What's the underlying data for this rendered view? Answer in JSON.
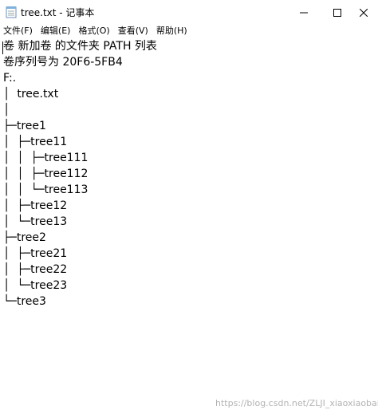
{
  "window": {
    "title": "tree.txt - 记事本"
  },
  "menu": {
    "items": [
      "文件(F)",
      "编辑(E)",
      "格式(O)",
      "查看(V)",
      "帮助(H)"
    ]
  },
  "editor": {
    "lines": [
      "卷 新加卷 的文件夹 PATH 列表",
      "卷序列号为 20F6-5FB4",
      "F:.",
      "│  tree.txt",
      "│",
      "├─tree1",
      "│  ├─tree11",
      "│  │  ├─tree111",
      "│  │  ├─tree112",
      "│  │  └─tree113",
      "│  ├─tree12",
      "│  └─tree13",
      "├─tree2",
      "│  ├─tree21",
      "│  ├─tree22",
      "│  └─tree23",
      "└─tree3"
    ]
  },
  "watermark": {
    "text": "https://blog.csdn.net/ZLJI_xiaoxiaobai"
  },
  "icons": {
    "app": "notepad-icon",
    "minimize": "minimize-icon",
    "maximize": "maximize-icon",
    "close": "close-icon"
  }
}
